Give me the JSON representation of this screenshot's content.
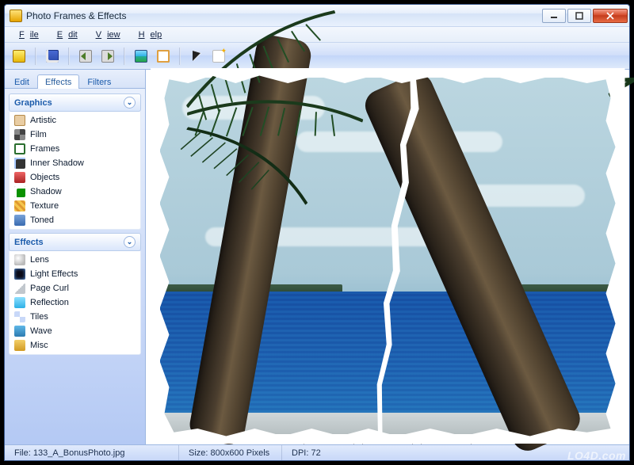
{
  "window": {
    "title": "Photo Frames & Effects"
  },
  "menu": {
    "file": "File",
    "edit": "Edit",
    "view": "View",
    "help": "Help"
  },
  "tabs": {
    "edit": "Edit",
    "effects": "Effects",
    "filters": "Filters",
    "active": "Effects"
  },
  "panel_graphics": {
    "title": "Graphics",
    "items": [
      "Artistic",
      "Film",
      "Frames",
      "Inner Shadow",
      "Objects",
      "Shadow",
      "Texture",
      "Toned"
    ]
  },
  "panel_effects": {
    "title": "Effects",
    "items": [
      "Lens",
      "Light Effects",
      "Page Curl",
      "Reflection",
      "Tiles",
      "Wave",
      "Misc"
    ]
  },
  "actions": {
    "undo": "Undo",
    "redo": "Redo",
    "original": "Original"
  },
  "status": {
    "file_label": "File:",
    "file_value": "133_A_BonusPhoto.jpg",
    "size_label": "Size:",
    "size_value": "800x600 Pixels",
    "dpi_label": "DPI:",
    "dpi_value": "72"
  },
  "watermark": "LO4D.com"
}
